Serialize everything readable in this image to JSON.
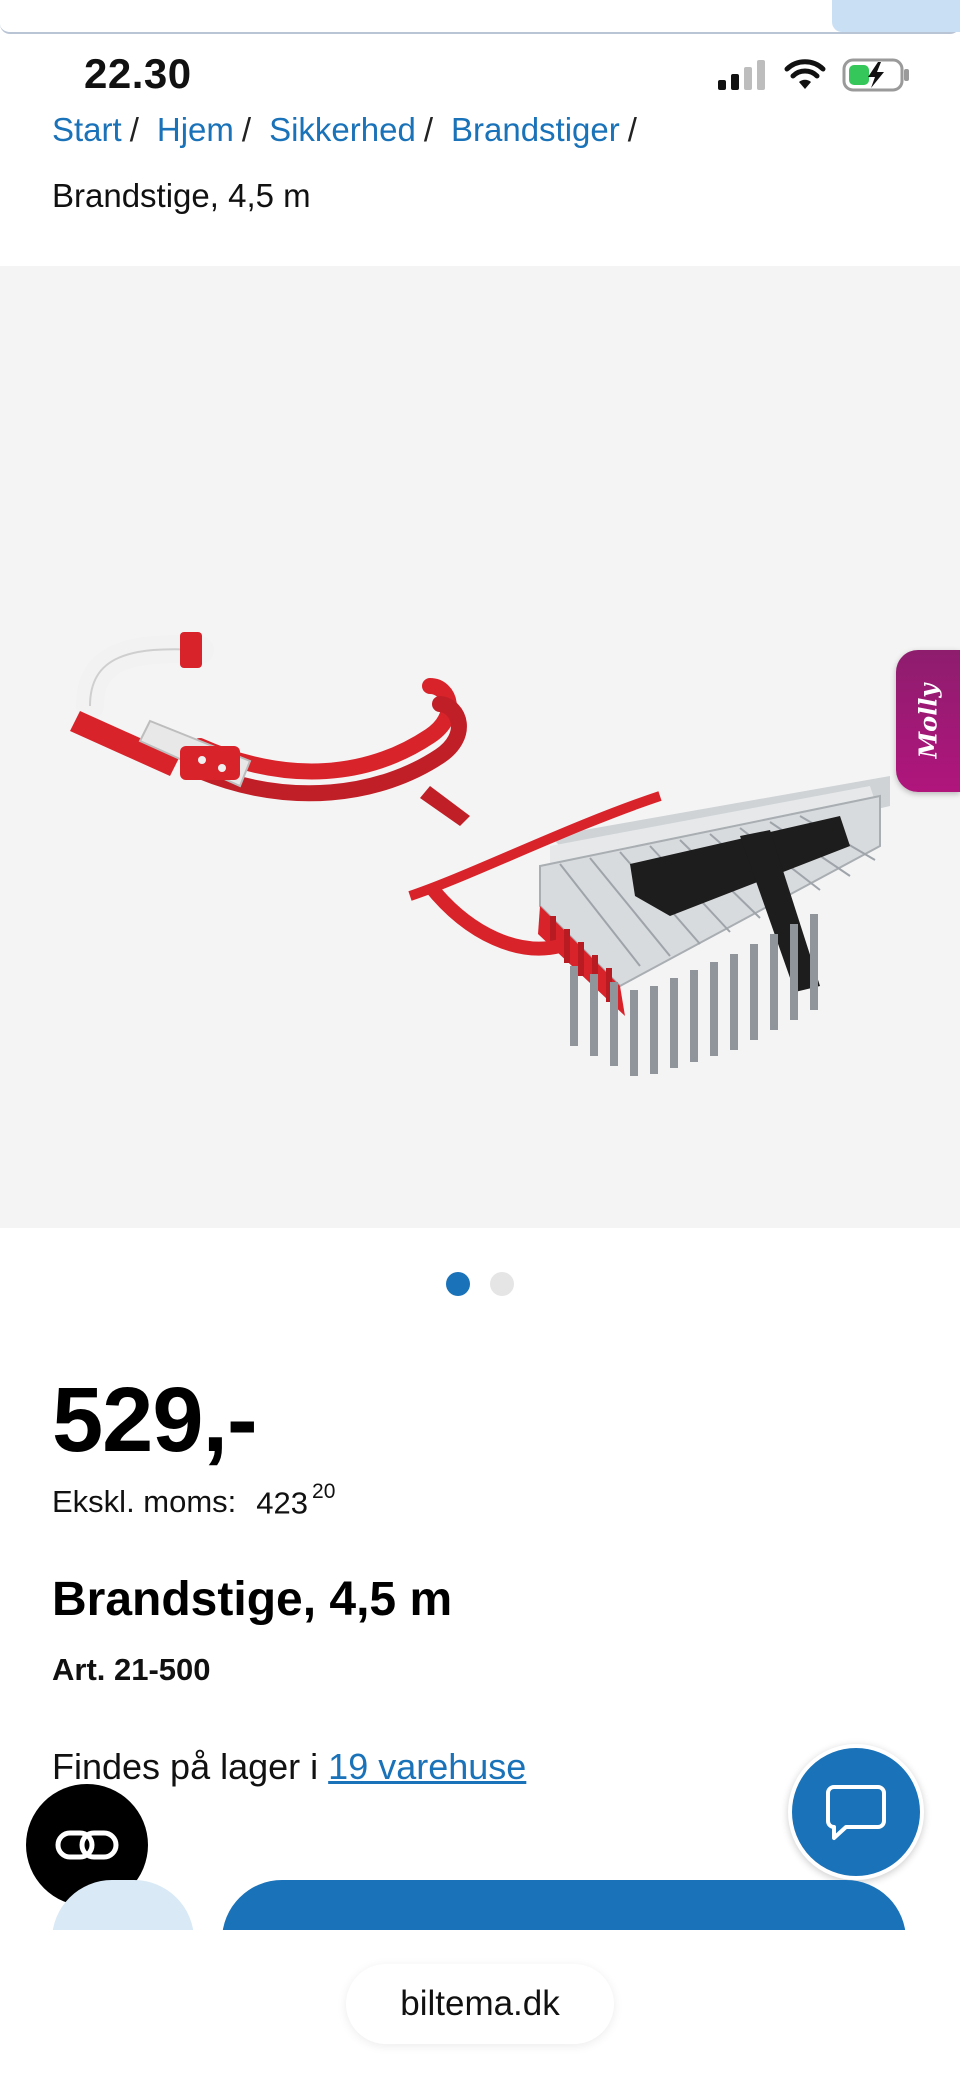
{
  "status_bar": {
    "time": "22.30",
    "icons": [
      "cellular-signal-icon",
      "wifi-icon",
      "battery-charging-icon"
    ]
  },
  "breadcrumb": {
    "items": [
      "Start",
      "Hjem",
      "Sikkerhed",
      "Brandstiger"
    ],
    "separator": "/",
    "current": "Brandstige, 4,5 m"
  },
  "gallery": {
    "molly_label": "Molly",
    "dots": {
      "count": 2,
      "active_index": 0
    }
  },
  "product": {
    "price": "529,-",
    "excl_vat_label": "Ekskl. moms:",
    "excl_vat_main": "423",
    "excl_vat_decimals": "20",
    "title": "Brandstige, 4,5 m",
    "article": "Art. 21-500",
    "stock_prefix": "Findes på lager i",
    "stock_link": "19 varehuse"
  },
  "browser": {
    "url": "biltema.dk"
  },
  "colors": {
    "accent": "#1a72b8",
    "molly": "#a3177a",
    "gallery_bg": "#f4f4f4",
    "ladder_red": "#d9232b"
  }
}
